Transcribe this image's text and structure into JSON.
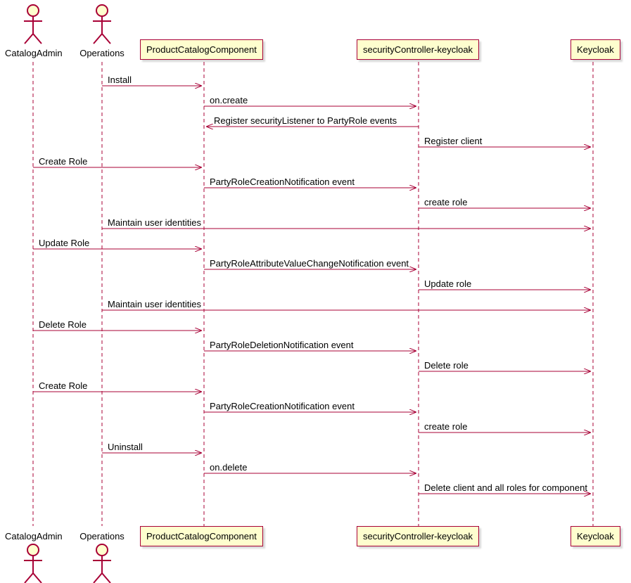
{
  "chart_data": {
    "type": "sequence_diagram",
    "participants": [
      {
        "name": "CatalogAdmin",
        "kind": "actor"
      },
      {
        "name": "Operations",
        "kind": "actor"
      },
      {
        "name": "ProductCatalogComponent",
        "kind": "component"
      },
      {
        "name": "securityController-keycloak",
        "kind": "component"
      },
      {
        "name": "Keycloak",
        "kind": "component"
      }
    ],
    "messages": [
      {
        "from": "Operations",
        "to": "ProductCatalogComponent",
        "label": "Install"
      },
      {
        "from": "ProductCatalogComponent",
        "to": "securityController-keycloak",
        "label": "on.create"
      },
      {
        "from": "securityController-keycloak",
        "to": "ProductCatalogComponent",
        "label": "Register securityListener to PartyRole events"
      },
      {
        "from": "securityController-keycloak",
        "to": "Keycloak",
        "label": "Register client"
      },
      {
        "from": "CatalogAdmin",
        "to": "ProductCatalogComponent",
        "label": "Create Role"
      },
      {
        "from": "ProductCatalogComponent",
        "to": "securityController-keycloak",
        "label": "PartyRoleCreationNotification event"
      },
      {
        "from": "securityController-keycloak",
        "to": "Keycloak",
        "label": "create role"
      },
      {
        "from": "Operations",
        "to": "Keycloak",
        "label": "Maintain user identities"
      },
      {
        "from": "CatalogAdmin",
        "to": "ProductCatalogComponent",
        "label": "Update Role"
      },
      {
        "from": "ProductCatalogComponent",
        "to": "securityController-keycloak",
        "label": "PartyRoleAttributeValueChangeNotification event"
      },
      {
        "from": "securityController-keycloak",
        "to": "Keycloak",
        "label": "Update role"
      },
      {
        "from": "Operations",
        "to": "Keycloak",
        "label": "Maintain user identities"
      },
      {
        "from": "CatalogAdmin",
        "to": "ProductCatalogComponent",
        "label": "Delete Role"
      },
      {
        "from": "ProductCatalogComponent",
        "to": "securityController-keycloak",
        "label": "PartyRoleDeletionNotification event"
      },
      {
        "from": "securityController-keycloak",
        "to": "Keycloak",
        "label": "Delete role"
      },
      {
        "from": "CatalogAdmin",
        "to": "ProductCatalogComponent",
        "label": "Create Role"
      },
      {
        "from": "ProductCatalogComponent",
        "to": "securityController-keycloak",
        "label": "PartyRoleCreationNotification event"
      },
      {
        "from": "securityController-keycloak",
        "to": "Keycloak",
        "label": "create role"
      },
      {
        "from": "Operations",
        "to": "ProductCatalogComponent",
        "label": "Uninstall"
      },
      {
        "from": "ProductCatalogComponent",
        "to": "securityController-keycloak",
        "label": "on.delete"
      },
      {
        "from": "securityController-keycloak",
        "to": "Keycloak",
        "label": "Delete client and all roles for component"
      }
    ]
  },
  "actors": {
    "catalogAdmin": "CatalogAdmin",
    "operations": "Operations"
  },
  "components": {
    "productCatalog": "ProductCatalogComponent",
    "securityController": "securityController-keycloak",
    "keycloak": "Keycloak"
  },
  "messages": {
    "m0": "Install",
    "m1": "on.create",
    "m2": "Register securityListener to PartyRole events",
    "m3": "Register client",
    "m4": "Create Role",
    "m5": "PartyRoleCreationNotification event",
    "m6": "create role",
    "m7": "Maintain user identities",
    "m8": "Update Role",
    "m9": "PartyRoleAttributeValueChangeNotification event",
    "m10": "Update role",
    "m11": "Maintain user identities",
    "m12": "Delete Role",
    "m13": "PartyRoleDeletionNotification event",
    "m14": "Delete role",
    "m15": "Create Role",
    "m16": "PartyRoleCreationNotification event",
    "m17": "create role",
    "m18": "Uninstall",
    "m19": "on.delete",
    "m20": "Delete client and all roles for component"
  }
}
